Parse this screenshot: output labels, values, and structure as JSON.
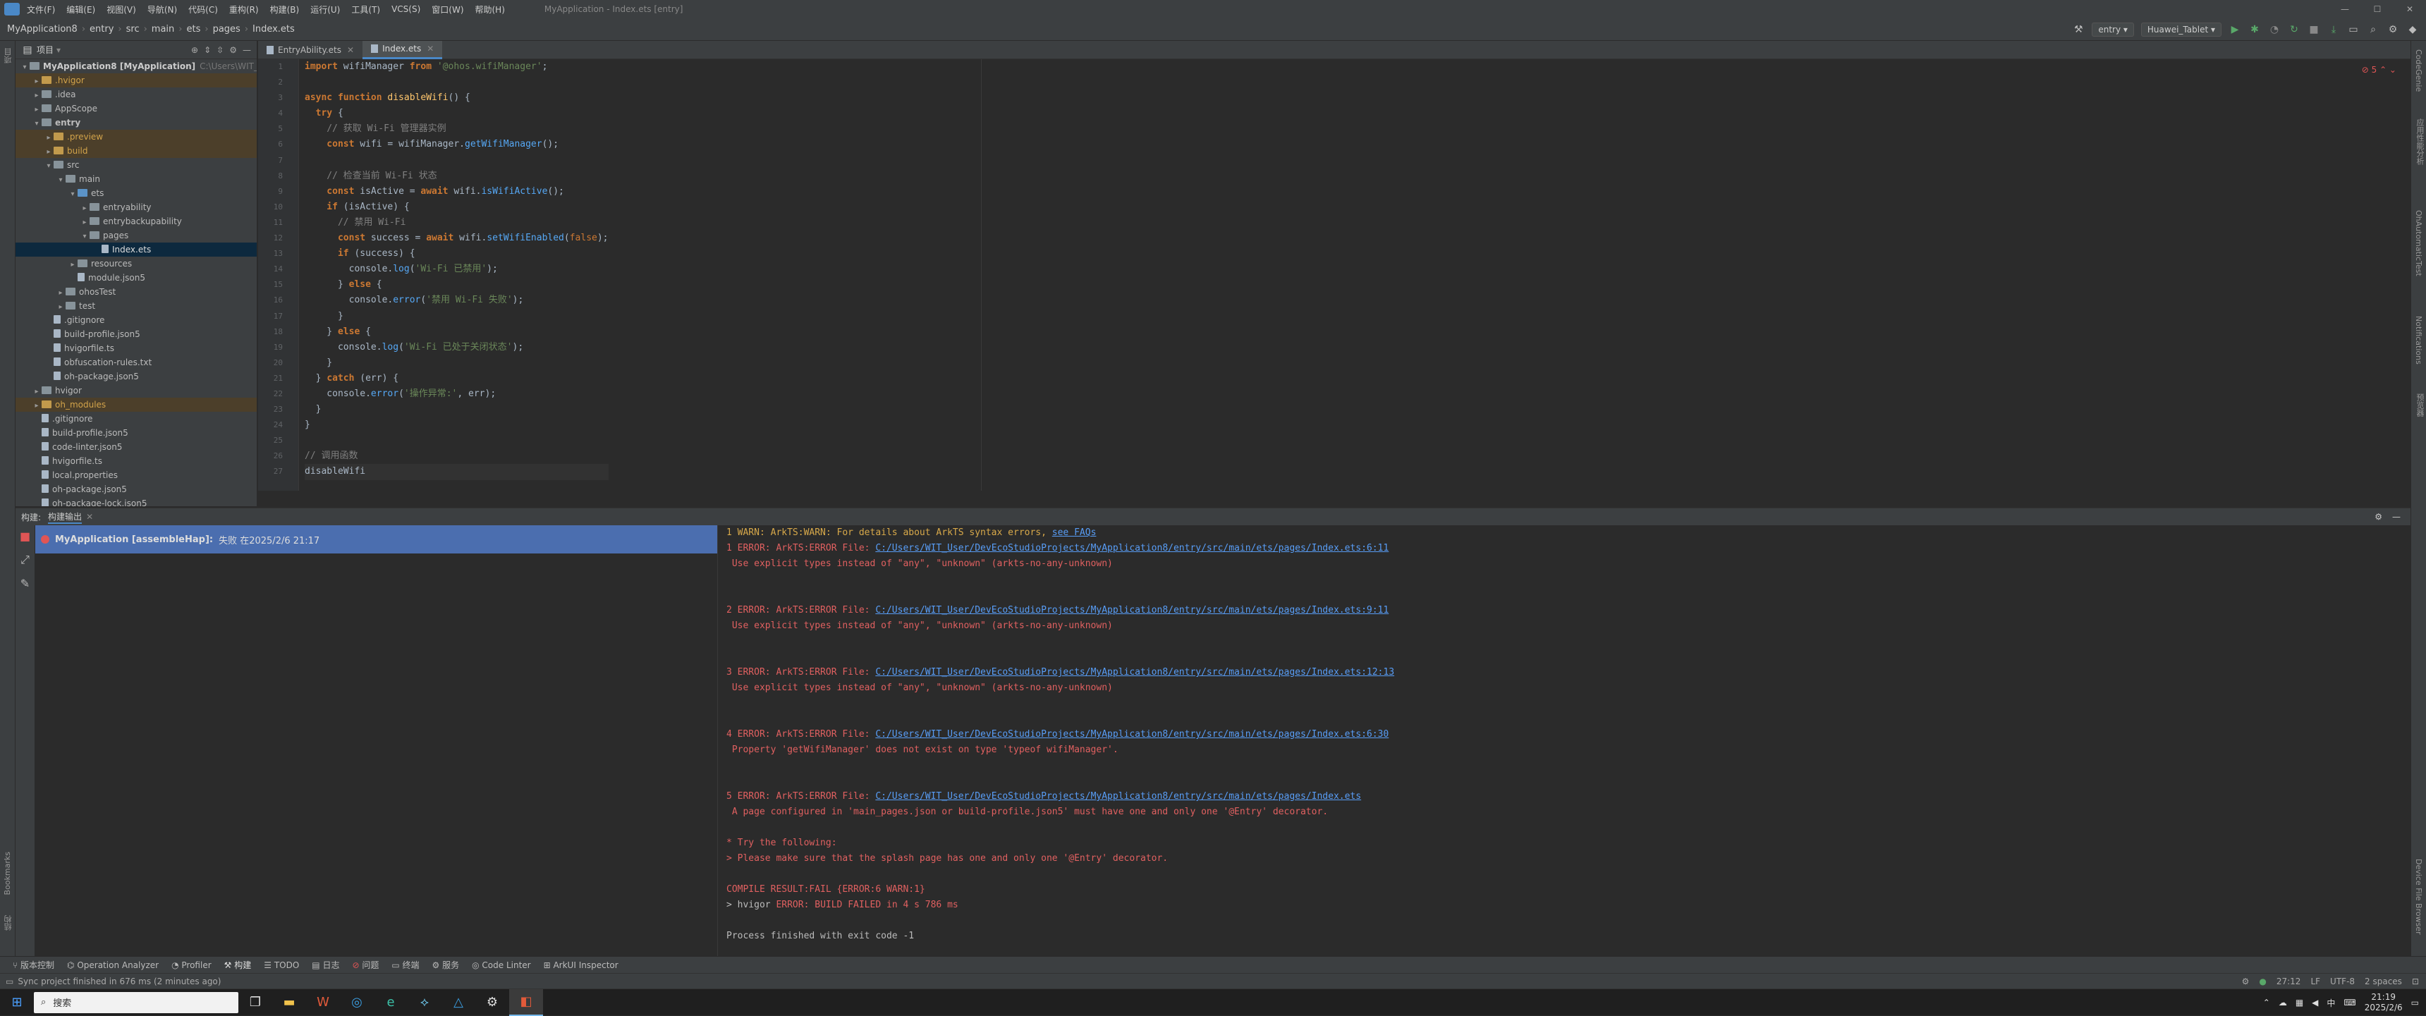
{
  "menubar": {
    "items": [
      "文件(F)",
      "编辑(E)",
      "视图(V)",
      "导航(N)",
      "代码(C)",
      "重构(R)",
      "构建(B)",
      "运行(U)",
      "工具(T)",
      "VCS(S)",
      "窗口(W)",
      "帮助(H)"
    ],
    "window_title": "MyApplication - Index.ets [entry]"
  },
  "navbar": {
    "crumbs": [
      "MyApplication8",
      "entry",
      "src",
      "main",
      "ets",
      "pages",
      "Index.ets"
    ],
    "module_select": "entry",
    "device_select": "Huawei_Tablet"
  },
  "project_panel": {
    "title": "项目",
    "tree": [
      {
        "depth": 0,
        "label": "MyApplication8 [MyApplication]",
        "hint": "C:\\Users\\WIT_Us",
        "type": "folder",
        "expanded": true,
        "style": "root"
      },
      {
        "depth": 1,
        "label": ".hvigor",
        "type": "folder",
        "expanded": false,
        "style": "excluded"
      },
      {
        "depth": 1,
        "label": ".idea",
        "type": "folder",
        "expanded": false,
        "style": ""
      },
      {
        "depth": 1,
        "label": "AppScope",
        "type": "folder",
        "expanded": false,
        "style": ""
      },
      {
        "depth": 1,
        "label": "entry",
        "type": "folder",
        "expanded": true,
        "style": "bold"
      },
      {
        "depth": 2,
        "label": ".preview",
        "type": "folder",
        "expanded": false,
        "style": "excluded"
      },
      {
        "depth": 2,
        "label": "build",
        "type": "folder",
        "expanded": false,
        "style": "excluded"
      },
      {
        "depth": 2,
        "label": "src",
        "type": "folder",
        "expanded": true,
        "style": ""
      },
      {
        "depth": 3,
        "label": "main",
        "type": "folder",
        "expanded": true,
        "style": ""
      },
      {
        "depth": 4,
        "label": "ets",
        "type": "folder",
        "expanded": true,
        "style": "blue"
      },
      {
        "depth": 5,
        "label": "entryability",
        "type": "folder",
        "expanded": false,
        "style": ""
      },
      {
        "depth": 5,
        "label": "entrybackupability",
        "type": "folder",
        "expanded": false,
        "style": ""
      },
      {
        "depth": 5,
        "label": "pages",
        "type": "folder",
        "expanded": true,
        "style": ""
      },
      {
        "depth": 6,
        "label": "Index.ets",
        "type": "file",
        "expanded": null,
        "style": "selected"
      },
      {
        "depth": 4,
        "label": "resources",
        "type": "folder",
        "expanded": false,
        "style": ""
      },
      {
        "depth": 4,
        "label": "module.json5",
        "type": "file",
        "expanded": null,
        "style": ""
      },
      {
        "depth": 3,
        "label": "ohosTest",
        "type": "folder",
        "expanded": false,
        "style": ""
      },
      {
        "depth": 3,
        "label": "test",
        "type": "folder",
        "expanded": false,
        "style": ""
      },
      {
        "depth": 2,
        "label": ".gitignore",
        "type": "file",
        "expanded": null,
        "style": ""
      },
      {
        "depth": 2,
        "label": "build-profile.json5",
        "type": "file",
        "expanded": null,
        "style": ""
      },
      {
        "depth": 2,
        "label": "hvigorfile.ts",
        "type": "file",
        "expanded": null,
        "style": ""
      },
      {
        "depth": 2,
        "label": "obfuscation-rules.txt",
        "type": "file",
        "expanded": null,
        "style": ""
      },
      {
        "depth": 2,
        "label": "oh-package.json5",
        "type": "file",
        "expanded": null,
        "style": ""
      },
      {
        "depth": 1,
        "label": "hvigor",
        "type": "folder",
        "expanded": false,
        "style": ""
      },
      {
        "depth": 1,
        "label": "oh_modules",
        "type": "folder",
        "expanded": false,
        "style": "excluded"
      },
      {
        "depth": 1,
        "label": ".gitignore",
        "type": "file",
        "expanded": null,
        "style": ""
      },
      {
        "depth": 1,
        "label": "build-profile.json5",
        "type": "file",
        "expanded": null,
        "style": ""
      },
      {
        "depth": 1,
        "label": "code-linter.json5",
        "type": "file",
        "expanded": null,
        "style": ""
      },
      {
        "depth": 1,
        "label": "hvigorfile.ts",
        "type": "file",
        "expanded": null,
        "style": ""
      },
      {
        "depth": 1,
        "label": "local.properties",
        "type": "file",
        "expanded": null,
        "style": ""
      },
      {
        "depth": 1,
        "label": "oh-package.json5",
        "type": "file",
        "expanded": null,
        "style": ""
      },
      {
        "depth": 1,
        "label": "oh-package-lock.json5",
        "type": "file",
        "expanded": null,
        "style": ""
      }
    ]
  },
  "editor": {
    "tabs": [
      {
        "label": "EntryAbility.ets",
        "active": false
      },
      {
        "label": "Index.ets",
        "active": true
      }
    ],
    "error_badge": "5",
    "line_numbers": [
      "1",
      "2",
      "3",
      "4",
      "5",
      "6",
      "7",
      "8",
      "9",
      "10",
      "11",
      "12",
      "13",
      "14",
      "15",
      "16",
      "17",
      "18",
      "19",
      "20",
      "21",
      "22",
      "23",
      "24",
      "25",
      "26",
      "27"
    ],
    "lines": [
      [
        {
          "t": "import ",
          "c": "kw"
        },
        {
          "t": "wifiManager ",
          "c": ""
        },
        {
          "t": "from ",
          "c": "kw"
        },
        {
          "t": "'@ohos.wifiManager'",
          "c": "str"
        },
        {
          "t": ";",
          "c": ""
        }
      ],
      [],
      [
        {
          "t": "async function ",
          "c": "kw"
        },
        {
          "t": "disableWifi",
          "c": "fn"
        },
        {
          "t": "() {",
          "c": ""
        }
      ],
      [
        {
          "t": "  try ",
          "c": "kw"
        },
        {
          "t": "{",
          "c": ""
        }
      ],
      [
        {
          "t": "    // 获取 Wi-Fi 管理器实例",
          "c": "cmt"
        }
      ],
      [
        {
          "t": "    const ",
          "c": "kw"
        },
        {
          "t": "wifi = wifiManager.",
          "c": ""
        },
        {
          "t": "getWifiManager",
          "c": "mth"
        },
        {
          "t": "();",
          "c": ""
        }
      ],
      [],
      [
        {
          "t": "    // 检查当前 Wi-Fi 状态",
          "c": "cmt"
        }
      ],
      [
        {
          "t": "    const ",
          "c": "kw"
        },
        {
          "t": "isActive = ",
          "c": ""
        },
        {
          "t": "await ",
          "c": "kw"
        },
        {
          "t": "wifi.",
          "c": ""
        },
        {
          "t": "isWifiActive",
          "c": "mth"
        },
        {
          "t": "();",
          "c": ""
        }
      ],
      [
        {
          "t": "    if ",
          "c": "kw"
        },
        {
          "t": "(isActive) {",
          "c": ""
        }
      ],
      [
        {
          "t": "      // 禁用 Wi-Fi",
          "c": "cmt"
        }
      ],
      [
        {
          "t": "      const ",
          "c": "kw"
        },
        {
          "t": "success = ",
          "c": ""
        },
        {
          "t": "await ",
          "c": "kw"
        },
        {
          "t": "wifi.",
          "c": ""
        },
        {
          "t": "setWifiEnabled",
          "c": "mth"
        },
        {
          "t": "(",
          "c": ""
        },
        {
          "t": "false",
          "c": "bool"
        },
        {
          "t": ");",
          "c": ""
        }
      ],
      [
        {
          "t": "      if ",
          "c": "kw"
        },
        {
          "t": "(success) {",
          "c": ""
        }
      ],
      [
        {
          "t": "        console.",
          "c": ""
        },
        {
          "t": "log",
          "c": "mth"
        },
        {
          "t": "(",
          "c": ""
        },
        {
          "t": "'Wi-Fi 已禁用'",
          "c": "str"
        },
        {
          "t": ");",
          "c": ""
        }
      ],
      [
        {
          "t": "      } ",
          "c": ""
        },
        {
          "t": "else ",
          "c": "kw"
        },
        {
          "t": "{",
          "c": ""
        }
      ],
      [
        {
          "t": "        console.",
          "c": ""
        },
        {
          "t": "error",
          "c": "mth"
        },
        {
          "t": "(",
          "c": ""
        },
        {
          "t": "'禁用 Wi-Fi 失败'",
          "c": "str"
        },
        {
          "t": ");",
          "c": ""
        }
      ],
      [
        {
          "t": "      }",
          "c": ""
        }
      ],
      [
        {
          "t": "    } ",
          "c": ""
        },
        {
          "t": "else ",
          "c": "kw"
        },
        {
          "t": "{",
          "c": ""
        }
      ],
      [
        {
          "t": "      console.",
          "c": ""
        },
        {
          "t": "log",
          "c": "mth"
        },
        {
          "t": "(",
          "c": ""
        },
        {
          "t": "'Wi-Fi 已处于关闭状态'",
          "c": "str"
        },
        {
          "t": ");",
          "c": ""
        }
      ],
      [
        {
          "t": "    }",
          "c": ""
        }
      ],
      [
        {
          "t": "  } ",
          "c": ""
        },
        {
          "t": "catch ",
          "c": "kw"
        },
        {
          "t": "(err) {",
          "c": ""
        }
      ],
      [
        {
          "t": "    console.",
          "c": ""
        },
        {
          "t": "error",
          "c": "mth"
        },
        {
          "t": "(",
          "c": ""
        },
        {
          "t": "'操作异常:'",
          "c": "str"
        },
        {
          "t": ", err);",
          "c": ""
        }
      ],
      [
        {
          "t": "  }",
          "c": ""
        }
      ],
      [
        {
          "t": "}",
          "c": ""
        }
      ],
      [],
      [
        {
          "t": "// 调用函数",
          "c": "cmt"
        }
      ],
      [
        {
          "t": "disableWifi",
          "c": ""
        }
      ]
    ]
  },
  "build_panel": {
    "tabs": [
      "构建:",
      "构建输出"
    ],
    "task_label": "MyApplication [assembleHap]:",
    "task_status": "失败 在2025/2/6 21:17",
    "console": [
      {
        "kind": "warn",
        "text": "1 WARN: ArkTS:WARN: For details about ArkTS syntax errors, ",
        "link": "see FAQs"
      },
      {
        "kind": "err",
        "text": "1 ERROR: ArkTS:ERROR File: ",
        "link": "C:/Users/WIT_User/DevEcoStudioProjects/MyApplication8/entry/src/main/ets/pages/Index.ets:6:11"
      },
      {
        "kind": "err",
        "text": " Use explicit types instead of \"any\", \"unknown\" (arkts-no-any-unknown)",
        "link": ""
      },
      {
        "kind": "blank",
        "text": "",
        "link": ""
      },
      {
        "kind": "blank",
        "text": "",
        "link": ""
      },
      {
        "kind": "err",
        "text": "2 ERROR: ArkTS:ERROR File: ",
        "link": "C:/Users/WIT_User/DevEcoStudioProjects/MyApplication8/entry/src/main/ets/pages/Index.ets:9:11"
      },
      {
        "kind": "err",
        "text": " Use explicit types instead of \"any\", \"unknown\" (arkts-no-any-unknown)",
        "link": ""
      },
      {
        "kind": "blank",
        "text": "",
        "link": ""
      },
      {
        "kind": "blank",
        "text": "",
        "link": ""
      },
      {
        "kind": "err",
        "text": "3 ERROR: ArkTS:ERROR File: ",
        "link": "C:/Users/WIT_User/DevEcoStudioProjects/MyApplication8/entry/src/main/ets/pages/Index.ets:12:13"
      },
      {
        "kind": "err",
        "text": " Use explicit types instead of \"any\", \"unknown\" (arkts-no-any-unknown)",
        "link": ""
      },
      {
        "kind": "blank",
        "text": "",
        "link": ""
      },
      {
        "kind": "blank",
        "text": "",
        "link": ""
      },
      {
        "kind": "err",
        "text": "4 ERROR: ArkTS:ERROR File: ",
        "link": "C:/Users/WIT_User/DevEcoStudioProjects/MyApplication8/entry/src/main/ets/pages/Index.ets:6:30"
      },
      {
        "kind": "err",
        "text": " Property 'getWifiManager' does not exist on type 'typeof wifiManager'.",
        "link": ""
      },
      {
        "kind": "blank",
        "text": "",
        "link": ""
      },
      {
        "kind": "blank",
        "text": "",
        "link": ""
      },
      {
        "kind": "err",
        "text": "5 ERROR: ArkTS:ERROR File: ",
        "link": "C:/Users/WIT_User/DevEcoStudioProjects/MyApplication8/entry/src/main/ets/pages/Index.ets"
      },
      {
        "kind": "err",
        "text": " A page configured in 'main_pages.json or build-profile.json5' must have one and only one '@Entry' decorator.",
        "link": ""
      },
      {
        "kind": "blank",
        "text": "",
        "link": ""
      },
      {
        "kind": "err",
        "text": "* Try the following:",
        "link": ""
      },
      {
        "kind": "err",
        "text": "> Please make sure that the splash page has one and only one '@Entry' decorator.",
        "link": ""
      },
      {
        "kind": "blank",
        "text": "",
        "link": ""
      },
      {
        "kind": "err",
        "text": "COMPILE RESULT:FAIL {ERROR:6 WARN:1}",
        "link": ""
      },
      {
        "kind": "mixed",
        "text": "> hvigor ",
        "link": "",
        "rest": "ERROR: BUILD FAILED in 4 s 786 ms"
      },
      {
        "kind": "blank",
        "text": "",
        "link": ""
      },
      {
        "kind": "plain",
        "text": "Process finished with exit code -1",
        "link": ""
      }
    ]
  },
  "bottom_tabs": [
    "版本控制",
    "Operation Analyzer",
    "Profiler",
    "构建",
    "TODO",
    "日志",
    "问题",
    "终端",
    "服务",
    "Code Linter",
    "ArkUI Inspector"
  ],
  "left_strip": [
    "项目",
    "Bookmarks",
    "结构"
  ],
  "right_strip": [
    "CodeGenie",
    "应用性能分析",
    "OhAutomaticTest",
    "Notifications",
    "预览器",
    "Device File Browser"
  ],
  "status": {
    "message": "Sync project finished in 676 ms (2 minutes ago)",
    "position": "27:12",
    "line_sep": "LF",
    "encoding": "UTF-8",
    "indent": "2 spaces"
  },
  "taskbar": {
    "search_placeholder": "搜索",
    "time": "21:19",
    "date": "2025/2/6",
    "ime": "中"
  }
}
